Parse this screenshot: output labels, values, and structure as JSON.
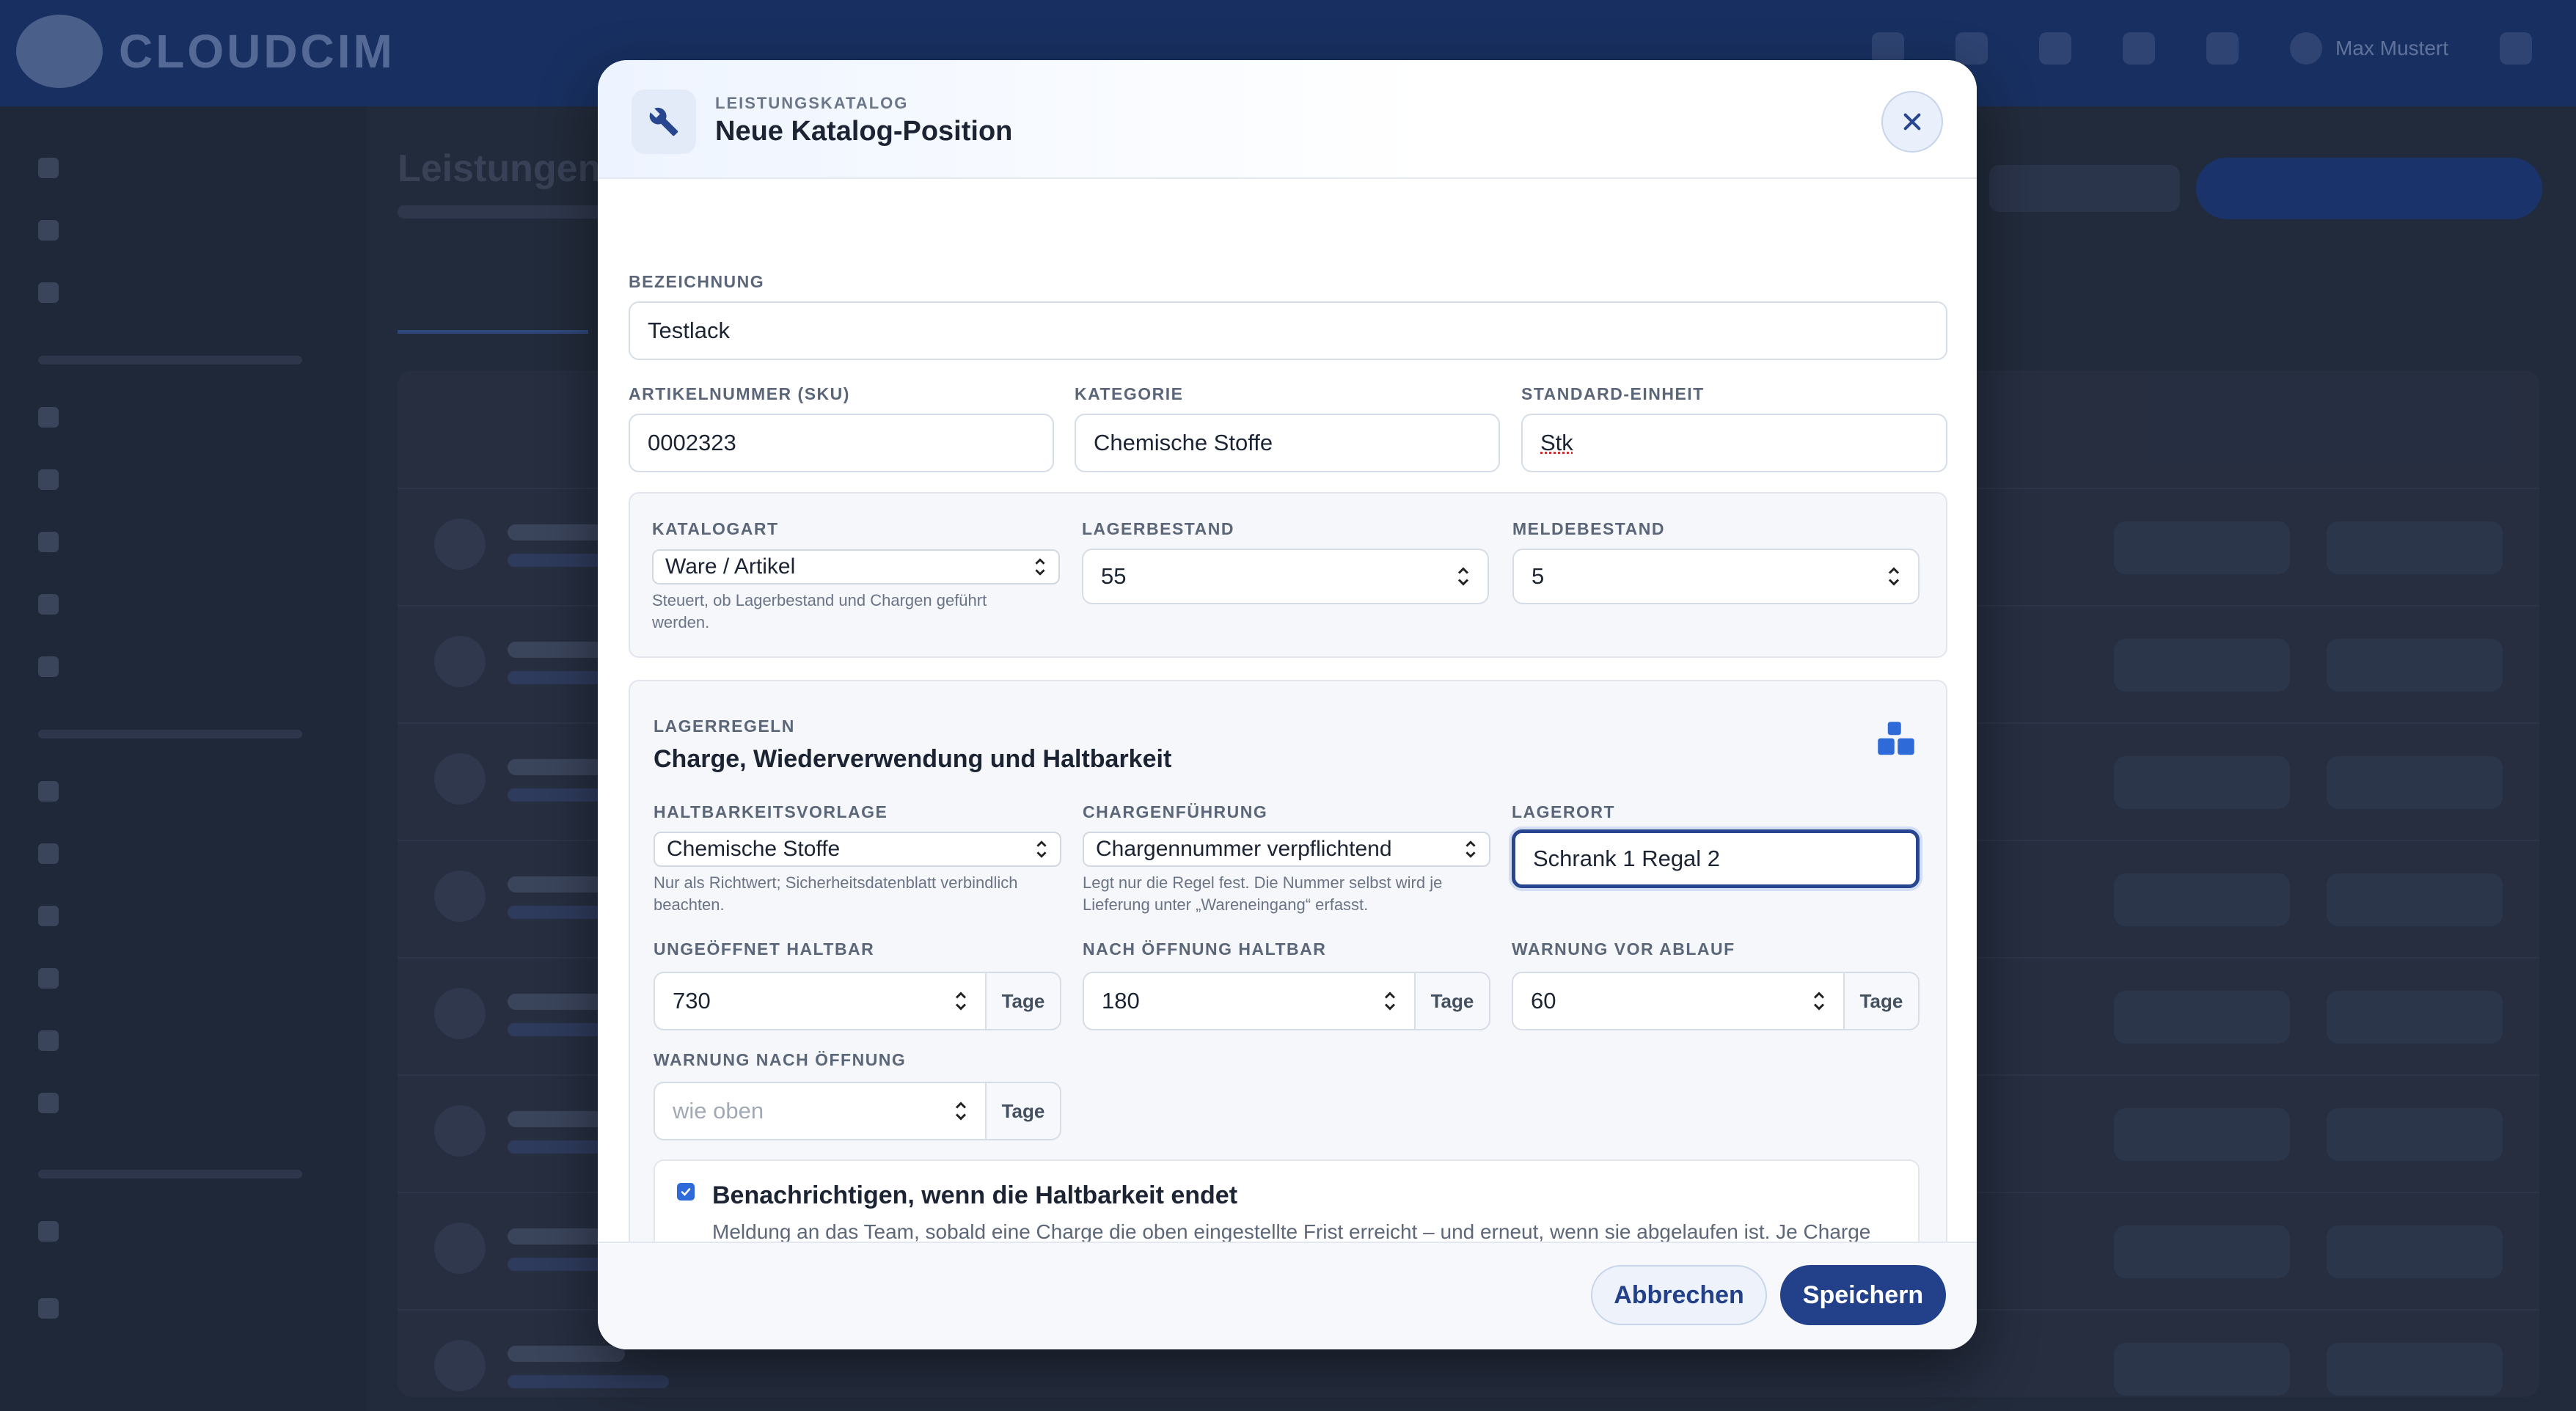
{
  "app": {
    "brand": "CLOUDCIM",
    "page_title": "Leistungen",
    "user_name": "Max Mustert"
  },
  "modal": {
    "eyebrow": "LEISTUNGSKATALOG",
    "title": "Neue Katalog-Position",
    "close_icon": "close-icon",
    "header_icon": "wrench-icon",
    "fields": {
      "bezeichnung": {
        "label": "BEZEICHNUNG",
        "value": "Testlack"
      },
      "artikelnummer": {
        "label": "ARTIKELNUMMER (SKU)",
        "value": "0002323"
      },
      "kategorie": {
        "label": "KATEGORIE",
        "value": "Chemische Stoffe"
      },
      "standard_einheit": {
        "label": "STANDARD-EINHEIT",
        "value": "Stk"
      },
      "katalogart": {
        "label": "KATALOGART",
        "value": "Ware / Artikel",
        "hint": "Steuert, ob Lagerbestand und Chargen geführt werden."
      },
      "lagerbestand": {
        "label": "LAGERBESTAND",
        "value": "55"
      },
      "meldebestand": {
        "label": "MELDEBESTAND",
        "value": "5"
      }
    },
    "lagerregeln": {
      "eyebrow": "LAGERREGELN",
      "title": "Charge, Wiederverwendung und Haltbarkeit",
      "icon": "boxes-icon",
      "haltbarkeitsvorlage": {
        "label": "HALTBARKEITSVORLAGE",
        "value": "Chemische Stoffe",
        "hint": "Nur als Richtwert; Sicherheitsdatenblatt verbindlich beachten."
      },
      "chargenfuehrung": {
        "label": "CHARGENFÜHRUNG",
        "value": "Chargennummer verpflichtend",
        "hint": "Legt nur die Regel fest. Die Nummer selbst wird je Lieferung unter „Wareneingang“ erfasst."
      },
      "lagerort": {
        "label": "LAGERORT",
        "value": "Schrank 1 Regal 2"
      },
      "ungeoeffnet": {
        "label": "UNGEÖFFNET HALTBAR",
        "value": "730",
        "unit": "Tage"
      },
      "nach_oeffnung": {
        "label": "NACH ÖFFNUNG HALTBAR",
        "value": "180",
        "unit": "Tage"
      },
      "warnung_ablauf": {
        "label": "WARNUNG VOR ABLAUF",
        "value": "60",
        "unit": "Tage"
      },
      "warnung_oeffnung": {
        "label": "WARNUNG NACH ÖFFNUNG",
        "placeholder": "wie oben",
        "unit": "Tage"
      },
      "notify": {
        "checked": true,
        "title": "Benachrichtigen, wenn die Haltbarkeit endet",
        "description": "Meldung an das Team, sobald eine Charge die oben eingestellte Frist erreicht – und erneut, wenn sie abgelaufen ist. Je Charge einmalig."
      }
    },
    "footer": {
      "cancel_label": "Abbrechen",
      "save_label": "Speichern"
    }
  },
  "colors": {
    "primary": "#22418a",
    "accent": "#2f6bd8",
    "focus_border": "#27468f"
  }
}
